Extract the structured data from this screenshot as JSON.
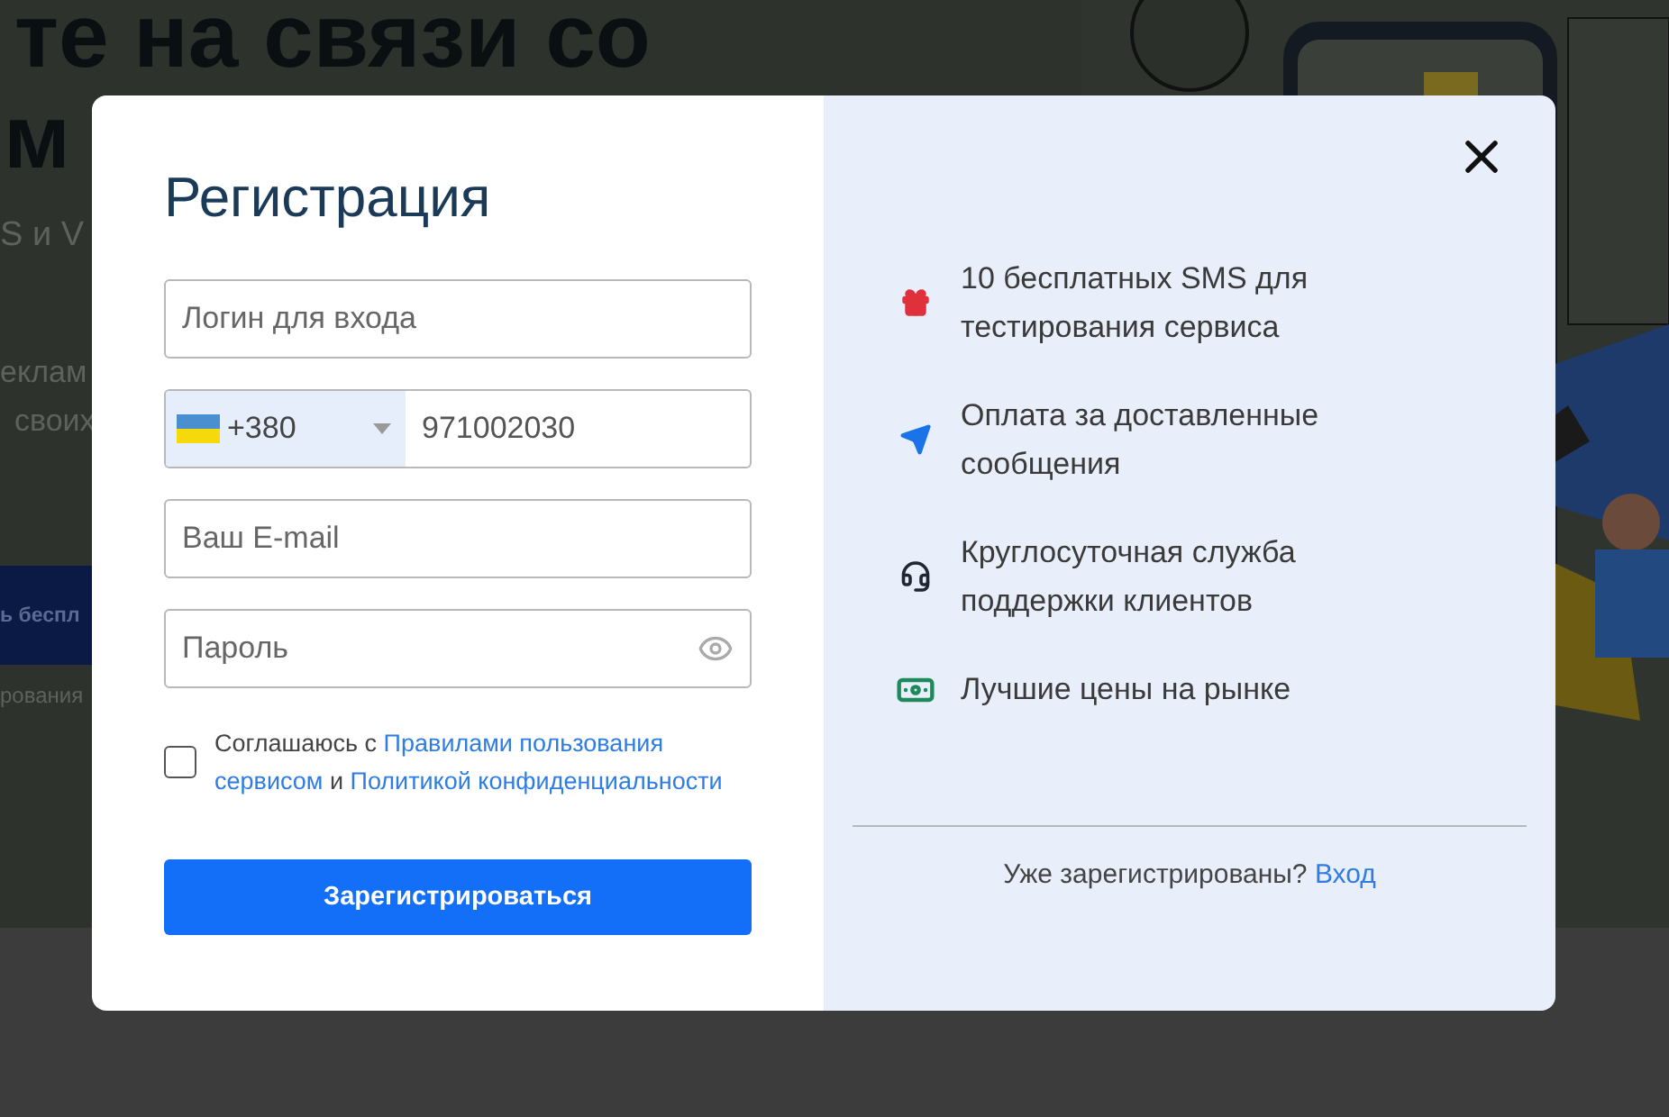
{
  "background": {
    "headline": "те на связи со",
    "headline_2": "м",
    "texts": [
      "S и V",
      "еклам",
      "своих"
    ],
    "button": "ь беспл",
    "note": "рования"
  },
  "modal": {
    "title": "Регистрация",
    "fields": [
      {
        "kind": "text",
        "placeholder": "Логин для входа"
      },
      {
        "kind": "phone",
        "country_code": "+380",
        "value": "971002030"
      },
      {
        "kind": "text",
        "placeholder": "Ваш E-mail"
      },
      {
        "kind": "password",
        "placeholder": "Пароль"
      }
    ],
    "agreement": {
      "checked": false,
      "parts": [
        {
          "kind": "text",
          "text": "Соглашаюсь с"
        },
        {
          "kind": "link",
          "text": "Правилами пользования"
        },
        {
          "kind": "link",
          "text": "сервисом"
        },
        {
          "kind": "text",
          "text": "и"
        },
        {
          "kind": "link",
          "text": "Политикой конфиденциальности"
        }
      ]
    },
    "submit": "Зарегистрироваться",
    "benefits": [
      {
        "kind": "gift",
        "text": "10 бесплатных SMS для тестирования сервиса"
      },
      {
        "kind": "plane",
        "text": "Оплата за доставленные сообщения"
      },
      {
        "kind": "support",
        "text": "Круглосуточная служба поддержки клиентов"
      },
      {
        "kind": "money",
        "text": "Лучшие цены на рынке"
      }
    ],
    "login_prompt": "Уже зарегистрированы?",
    "login_link": "Вход"
  }
}
